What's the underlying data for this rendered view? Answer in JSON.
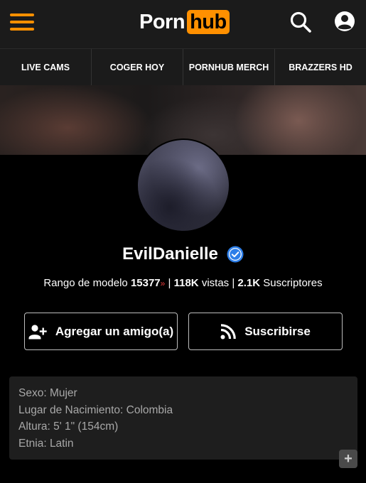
{
  "header": {
    "logo_part1": "Porn",
    "logo_part2": "hub",
    "icons": [
      "menu-icon",
      "search-icon",
      "user-icon"
    ]
  },
  "nav": {
    "items": [
      {
        "label": "LIVE CAMS"
      },
      {
        "label": "COGER HOY"
      },
      {
        "label": "PORNHUB MERCH"
      },
      {
        "label": "BRAZZERS HD"
      }
    ]
  },
  "profile": {
    "name": "EvilDanielle",
    "verified": true,
    "rank_label": "Rango de modelo",
    "rank_value": "15377",
    "views_value": "118K",
    "views_label": "vistas",
    "subs_value": "2.1K",
    "subs_label": "Suscriptores"
  },
  "actions": {
    "add_friend_label": "Agregar un amigo(a)",
    "subscribe_label": "Suscribirse"
  },
  "info": {
    "lines": [
      "Sexo: Mujer",
      "Lugar de Nacimiento: Colombia",
      "Altura: 5' 1\" (154cm)",
      "Etnia: Latin"
    ],
    "expand_symbol": "+"
  },
  "colors": {
    "accent": "#ff9000",
    "background": "#000000",
    "bar": "#1b1b1b",
    "verified": "#2d7ee8",
    "rank_down": "#e83b3b"
  }
}
